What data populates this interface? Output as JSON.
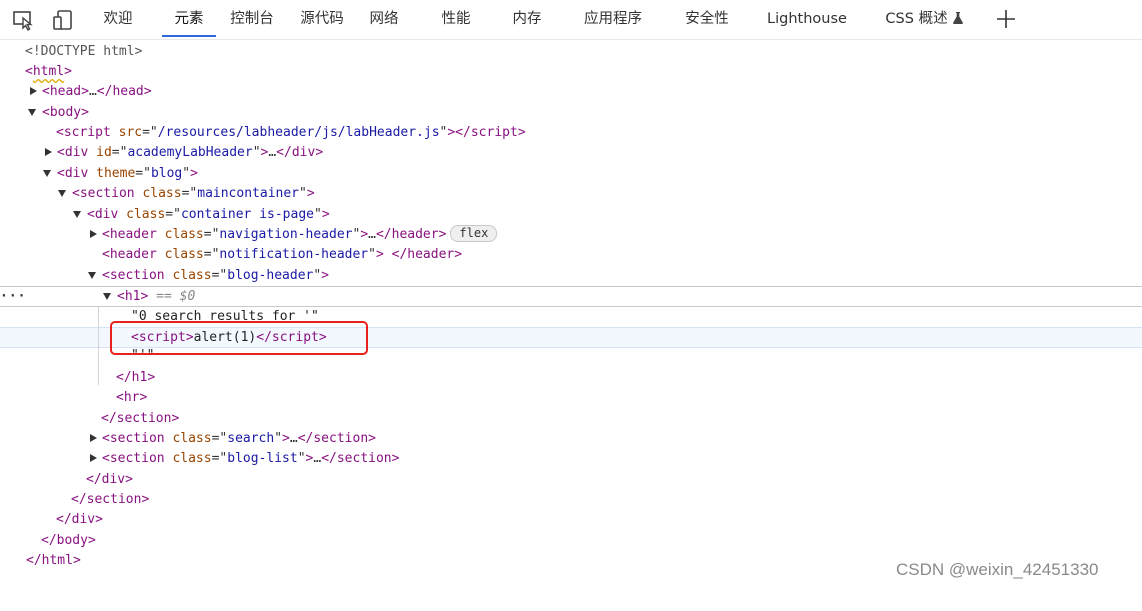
{
  "toolbar": {
    "icons": [
      "inspect-element-icon",
      "device-emulation-icon",
      "new-tab-icon"
    ],
    "tabs": [
      {
        "label": "欢迎",
        "active": false
      },
      {
        "label": "元素",
        "active": true
      },
      {
        "label": "控制台",
        "active": false
      },
      {
        "label": "源代码",
        "active": false
      },
      {
        "label": "网络",
        "active": false
      },
      {
        "label": "性能",
        "active": false
      },
      {
        "label": "内存",
        "active": false
      },
      {
        "label": "应用程序",
        "active": false
      },
      {
        "label": "安全性",
        "active": false
      },
      {
        "label": "Lighthouse",
        "active": false
      },
      {
        "label": "CSS 概述",
        "active": false,
        "icon": "flask-icon"
      }
    ]
  },
  "dom_tree": {
    "doctype": "<!DOCTYPE html>",
    "html_open": "html",
    "head_collapsed": "head",
    "body_open": "body",
    "script_labheader": {
      "tag": "script",
      "attr": "src",
      "value": "/resources/labheader/js/labHeader.js"
    },
    "div_academy": {
      "tag": "div",
      "attr": "id",
      "value": "academyLabHeader"
    },
    "div_theme": {
      "tag": "div",
      "attr": "theme",
      "value": "blog"
    },
    "section_main": {
      "tag": "section",
      "attr": "class",
      "value": "maincontainer"
    },
    "div_container": {
      "tag": "div",
      "attr": "class",
      "value": "container is-page"
    },
    "header_nav": {
      "tag": "header",
      "attr": "class",
      "value": "navigation-header",
      "badge": "flex"
    },
    "header_notif": {
      "tag": "header",
      "attr": "class",
      "value": "notification-header"
    },
    "section_blog_header": {
      "tag": "section",
      "attr": "class",
      "value": "blog-header"
    },
    "h1": {
      "tag": "h1",
      "selected_marker": "== $0"
    },
    "text_search": "\"0 search results for '\"",
    "script_alert": {
      "open": "script",
      "content": "alert(1)",
      "close": "script"
    },
    "text_quote": "\"'\"",
    "h1_close": "/h1",
    "hr": "hr",
    "section_close": "/section",
    "section_search": {
      "tag": "section",
      "attr": "class",
      "value": "search"
    },
    "section_bloglist": {
      "tag": "section",
      "attr": "class",
      "value": "blog-list"
    },
    "div_close_1": "/div",
    "section_close_2": "/section",
    "div_close_2": "/div",
    "body_close": "/body",
    "html_close": "/html",
    "ellipsis": "…",
    "selected_dots": "···"
  },
  "highlight": {
    "color": "#e8211c"
  },
  "watermark": "CSDN @weixin_42451330"
}
